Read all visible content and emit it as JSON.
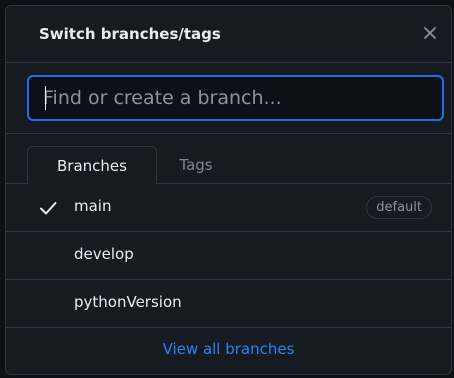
{
  "header": {
    "title": "Switch branches/tags",
    "close_icon": "close-icon"
  },
  "filter": {
    "value": "",
    "placeholder": "Find or create a branch..."
  },
  "tabs": [
    {
      "label": "Branches",
      "active": true
    },
    {
      "label": "Tags",
      "active": false
    }
  ],
  "branches": [
    {
      "name": "main",
      "selected": true,
      "badge": "default"
    },
    {
      "name": "develop",
      "selected": false,
      "badge": ""
    },
    {
      "name": "pythonVersion",
      "selected": false,
      "badge": ""
    }
  ],
  "footer": {
    "link_label": "View all branches"
  },
  "colors": {
    "accent": "#2f81f7",
    "focus_border": "#1f6feb",
    "background": "#161b22",
    "border": "#30363d",
    "text": "#e6edf3",
    "muted": "#8b949e"
  }
}
